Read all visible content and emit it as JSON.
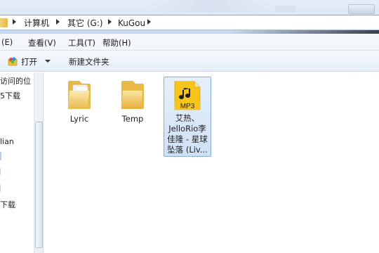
{
  "address": {
    "crumbs": [
      "计算机",
      "其它 (G:)",
      "KuGou"
    ]
  },
  "menu": [
    "(E)",
    "查看(V)",
    "工具(T)",
    "帮助(H)"
  ],
  "command": {
    "open_label": "打开",
    "new_folder_label": "新建文件夹"
  },
  "nav": {
    "items": [
      "访问的位",
      "5下载",
      "lian",
      "下载"
    ]
  },
  "items": [
    {
      "name": "Lyric",
      "type": "folder"
    },
    {
      "name": "Temp",
      "type": "folder"
    },
    {
      "name_lines": [
        "艾热、",
        "JelloRio李",
        "佳隆 - 星球",
        "坠落 (Liv..."
      ],
      "badge": "MP3",
      "type": "mp3",
      "selected": true
    }
  ],
  "colors": {
    "selection": "#cfe1f6",
    "mp3_badge": "#f4c21b"
  }
}
